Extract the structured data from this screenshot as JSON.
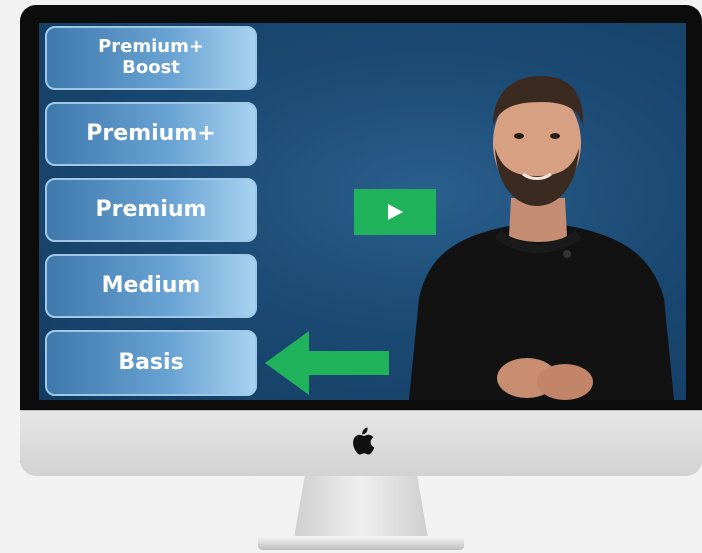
{
  "tiers": {
    "premium_plus_boost": [
      "Premium+",
      "Boost"
    ],
    "premium_plus": "Premium+",
    "premium": "Premium",
    "medium": "Medium",
    "basis": "Basis"
  },
  "icons": {
    "play": "play-icon",
    "arrow": "arrow-left-icon",
    "logo": "apple-logo-icon"
  },
  "colors": {
    "screen_bg": "#1b4a74",
    "tier_button": "#6aa4d4",
    "play_button": "#21b35b",
    "arrow": "#21b35b"
  }
}
